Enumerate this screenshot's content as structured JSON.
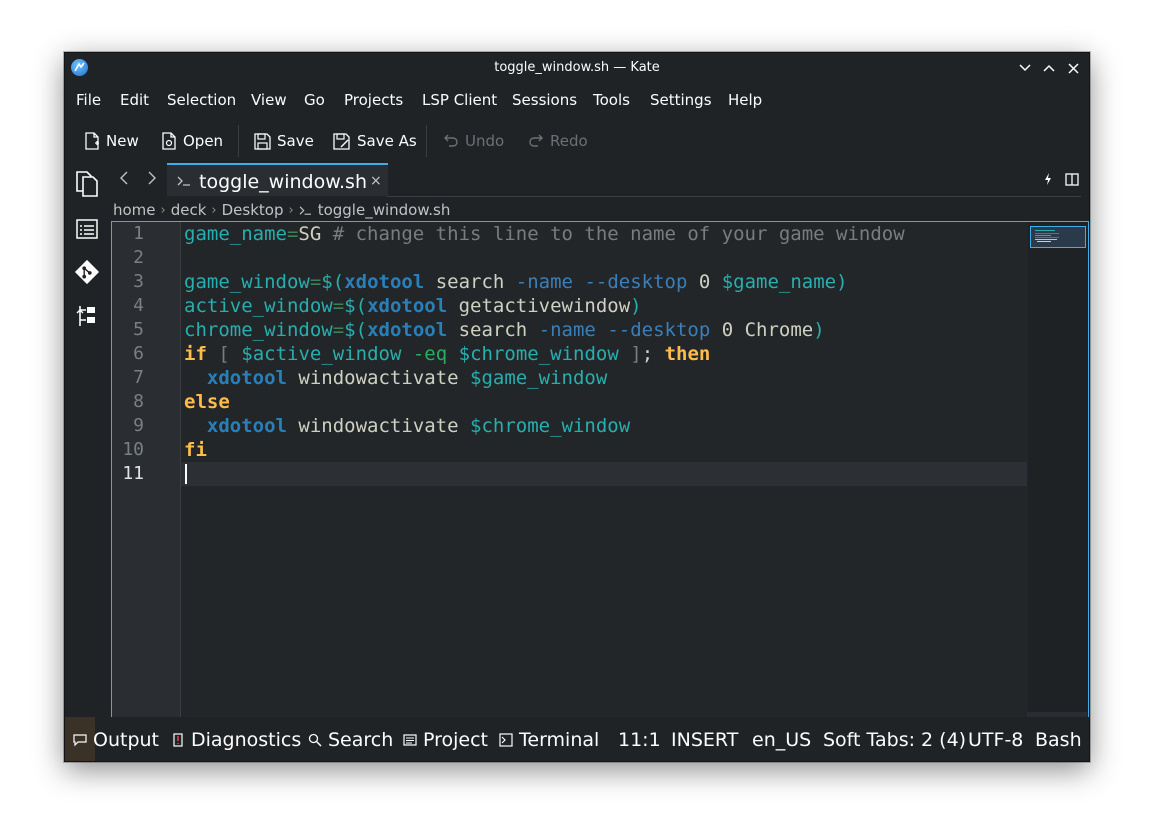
{
  "window": {
    "title": "toggle_window.sh — Kate"
  },
  "menu": [
    "File",
    "Edit",
    "Selection",
    "View",
    "Go",
    "Projects",
    "LSP Client",
    "Sessions",
    "Tools",
    "Settings",
    "Help"
  ],
  "toolbar": {
    "new_label": "New",
    "open_label": "Open",
    "save_label": "Save",
    "save_as_label": "Save As",
    "undo_label": "Undo",
    "redo_label": "Redo"
  },
  "tab": {
    "label": "toggle_window.sh",
    "close": "×"
  },
  "breadcrumb": [
    "home",
    "deck",
    "Desktop",
    "toggle_window.sh"
  ],
  "editor": {
    "line_numbers": [
      "1",
      "2",
      "3",
      "4",
      "5",
      "6",
      "7",
      "8",
      "9",
      "10",
      "11"
    ],
    "code": [
      [
        [
          "c-var",
          "game_name"
        ],
        [
          "c-op",
          "="
        ],
        [
          "c-plain",
          "SG "
        ],
        [
          "c-comment",
          "# change this line to the name of your game window"
        ]
      ],
      [],
      [
        [
          "c-var",
          "game_window"
        ],
        [
          "c-op",
          "="
        ],
        [
          "c-paren",
          "$("
        ],
        [
          "c-cmd",
          "xdotool"
        ],
        [
          "c-plain",
          " search "
        ],
        [
          "c-opt",
          "-name"
        ],
        [
          "c-plain",
          " "
        ],
        [
          "c-opt",
          "--desktop"
        ],
        [
          "c-plain",
          " 0 "
        ],
        [
          "c-var",
          "$game_name"
        ],
        [
          "c-paren",
          ")"
        ]
      ],
      [
        [
          "c-var",
          "active_window"
        ],
        [
          "c-op",
          "="
        ],
        [
          "c-paren",
          "$("
        ],
        [
          "c-cmd",
          "xdotool"
        ],
        [
          "c-plain",
          " getactivewindow"
        ],
        [
          "c-paren",
          ")"
        ]
      ],
      [
        [
          "c-var",
          "chrome_window"
        ],
        [
          "c-op",
          "="
        ],
        [
          "c-paren",
          "$("
        ],
        [
          "c-cmd",
          "xdotool"
        ],
        [
          "c-plain",
          " search "
        ],
        [
          "c-opt",
          "-name"
        ],
        [
          "c-plain",
          " "
        ],
        [
          "c-opt",
          "--desktop"
        ],
        [
          "c-plain",
          " 0 Chrome"
        ],
        [
          "c-paren",
          ")"
        ]
      ],
      [
        [
          "c-kw",
          "if"
        ],
        [
          "c-plain",
          " "
        ],
        [
          "c-comment",
          "["
        ],
        [
          "c-plain",
          " "
        ],
        [
          "c-var",
          "$active_window"
        ],
        [
          "c-plain",
          " "
        ],
        [
          "c-flag",
          "-eq"
        ],
        [
          "c-plain",
          " "
        ],
        [
          "c-var",
          "$chrome_window"
        ],
        [
          "c-plain",
          " "
        ],
        [
          "c-comment",
          "]"
        ],
        [
          "c-plain",
          "; "
        ],
        [
          "c-kw",
          "then"
        ]
      ],
      [
        [
          "c-plain",
          "  "
        ],
        [
          "c-cmd",
          "xdotool"
        ],
        [
          "c-plain",
          " windowactivate "
        ],
        [
          "c-var",
          "$game_window"
        ]
      ],
      [
        [
          "c-kw",
          "else"
        ]
      ],
      [
        [
          "c-plain",
          "  "
        ],
        [
          "c-cmd",
          "xdotool"
        ],
        [
          "c-plain",
          " windowactivate "
        ],
        [
          "c-var",
          "$chrome_window"
        ]
      ],
      [
        [
          "c-kw",
          "fi"
        ]
      ],
      []
    ]
  },
  "status": {
    "output": "Output",
    "diagnostics": "Diagnostics",
    "search": "Search",
    "project": "Project",
    "terminal": "Terminal",
    "position": "11:1",
    "mode": "INSERT",
    "language": "en_US",
    "indent": "Soft Tabs: 2 (4)",
    "encoding": "UTF-8",
    "syntax": "Bash"
  },
  "colors": {
    "accent": "#3daee9",
    "background": "#232629",
    "keyword": "#fdbc4b",
    "command": "#2980b9",
    "variable": "#27aeae"
  }
}
